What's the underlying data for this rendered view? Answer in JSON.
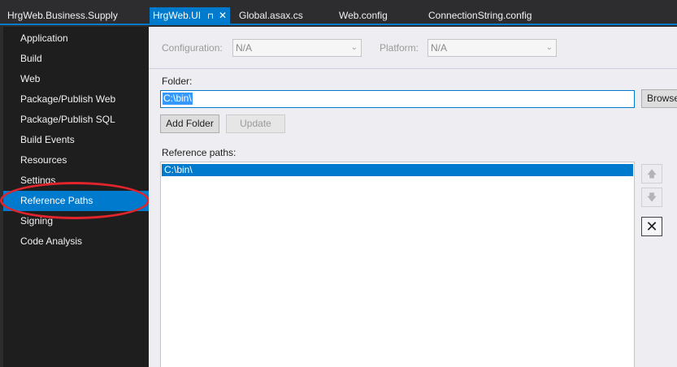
{
  "tabs": [
    {
      "label": "HrgWeb.Business.Supply"
    },
    {
      "label": "HrgWeb.UI",
      "pin": "⊓",
      "close": "✕"
    },
    {
      "label": "Global.asax.cs"
    },
    {
      "label": "Web.config"
    },
    {
      "label": "ConnectionString.config"
    }
  ],
  "sidebar": {
    "items": [
      {
        "label": "Application"
      },
      {
        "label": "Build"
      },
      {
        "label": "Web"
      },
      {
        "label": "Package/Publish Web"
      },
      {
        "label": "Package/Publish SQL"
      },
      {
        "label": "Build Events"
      },
      {
        "label": "Resources"
      },
      {
        "label": "Settings"
      },
      {
        "label": "Reference Paths"
      },
      {
        "label": "Signing"
      },
      {
        "label": "Code Analysis"
      }
    ],
    "selected": "Reference Paths"
  },
  "config": {
    "configuration_label": "Configuration:",
    "configuration_value": "N/A",
    "platform_label": "Platform:",
    "platform_value": "N/A"
  },
  "folder": {
    "label": "Folder:",
    "value": "C:\\bin\\",
    "browse_label": "Browse",
    "add_label": "Add Folder",
    "update_label": "Update"
  },
  "reference": {
    "label": "Reference paths:",
    "paths": [
      "C:\\bin\\"
    ],
    "up_icon": "arrow-up",
    "down_icon": "arrow-down",
    "remove_icon": "x-mark"
  },
  "colors": {
    "accent": "#007acc",
    "annotation": "#e0242b"
  }
}
